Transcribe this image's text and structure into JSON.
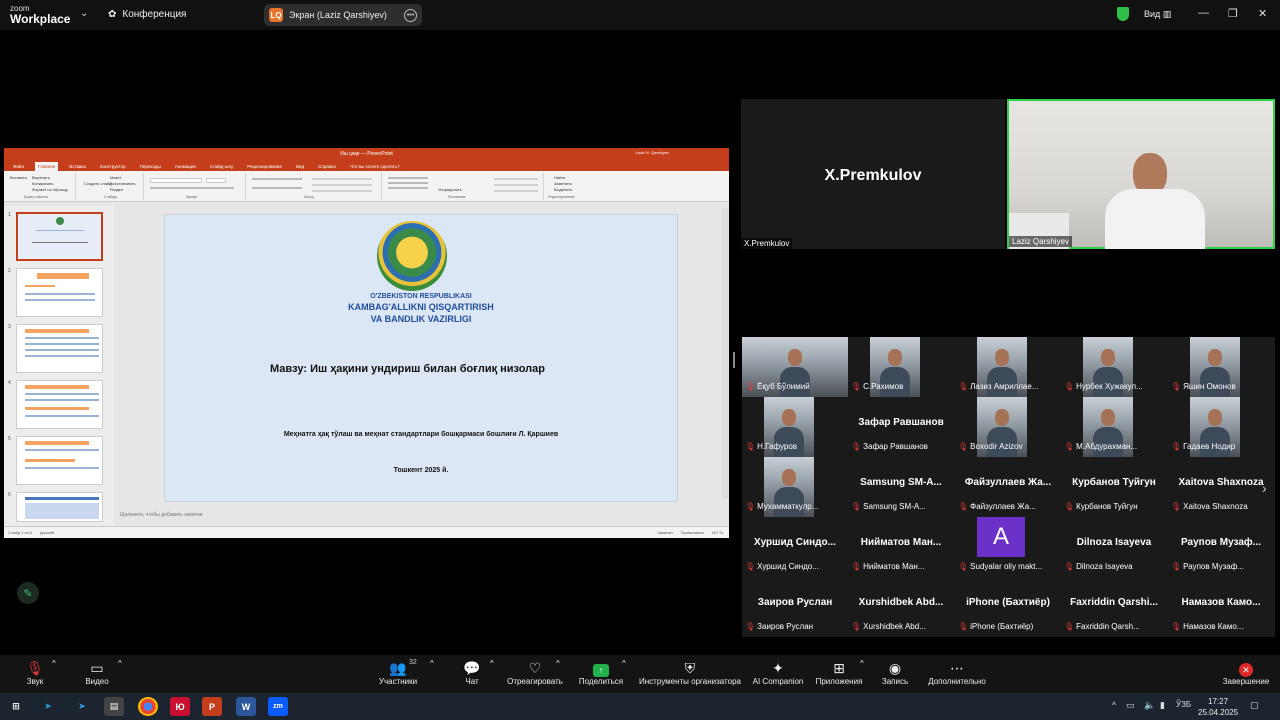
{
  "topbar": {
    "logo_line1": "zoom",
    "logo_line2": "Workplace",
    "conference_label": "Конференция",
    "share_badge": "LQ",
    "share_title": "Экран (Laziz Qarshiyev)",
    "view_label": "Вид",
    "colors": {
      "shield": "#2fbf4a",
      "share_badge": "#e8732a"
    }
  },
  "ppt": {
    "window_title": "Иш ҳақи — PowerPoint",
    "user_name": "Laziz N. Qarshiyev",
    "tabs": [
      "Файл",
      "Главная",
      "Вставка",
      "Конструктор",
      "Переходы",
      "Анимация",
      "Слайд-шоу",
      "Рецензирование",
      "Вид",
      "Справка",
      "Что вы хотите сделать?"
    ],
    "active_tab": "Главная",
    "ribbon": {
      "paste": "Вставить",
      "cut": "Вырезать",
      "copy": "Копировать",
      "format_painter": "Формат по образцу",
      "new_slide": "Создать слайд",
      "layout": "Макет",
      "reset": "Восстановить",
      "section": "Раздел",
      "arrange": "Упорядочить",
      "find": "Найти",
      "replace": "Заменить",
      "select": "Выделить",
      "groups": [
        "Буфер обмена",
        "Слайды",
        "Шрифт",
        "Абзац",
        "Рисование",
        "Редактирование"
      ]
    },
    "slide_numbers": [
      "1",
      "2",
      "3",
      "4",
      "5",
      "6"
    ],
    "slide": {
      "org_line1": "O'ZBEKISTON RESPUBLIKASI",
      "org_line2": "KAMBAG'ALLIKNI QISQARTIRISH",
      "org_line3": "VA BANDLIK VAZIRLIGI",
      "title": "Мавзу: Иш ҳақини ундириш билан боғлиқ низолар",
      "subtitle": "Меҳнатга ҳақ тўлаш ва меҳнат стандартлари бошқармаси бошлиғи Л. Қаршиев",
      "city": "Тошкент 2025 й."
    },
    "notes_placeholder": "Щелкните, чтобы добавить заметки",
    "status_slide": "Слайд 1 из 6",
    "status_lang": "русский",
    "status_notes": "Заметки",
    "status_comments": "Примечания",
    "status_zoom": "107 %"
  },
  "speakers": {
    "left": {
      "display_name": "X.Premkulov",
      "label": "X.Premkulov"
    },
    "right": {
      "label": "Laziz Qarshiyev"
    }
  },
  "gallery": [
    {
      "label": "Ёқуб Бўлимий",
      "video": true
    },
    {
      "label": "С.Рахимов",
      "video": true
    },
    {
      "label": "Лазиз Амриллае...",
      "video": true
    },
    {
      "label": "Нурбек Хужакул...",
      "video": true
    },
    {
      "label": "Яшин Омонов",
      "video": true
    },
    {
      "label": "Н.Гафуров",
      "video": true
    },
    {
      "label": "Зафар Равшанов",
      "big": "Зафар Равшанов",
      "video": false
    },
    {
      "label": "Boxodir Azizov",
      "video": true
    },
    {
      "label": "М.Абдурахман...",
      "video": true
    },
    {
      "label": "Гадаев Нодир",
      "video": true
    },
    {
      "label": "Мухамматкулр...",
      "video": true
    },
    {
      "label": "Samsung SM-A...",
      "big": "Samsung SM-A...",
      "video": false
    },
    {
      "label": "Файзуллаев Жа...",
      "big": "Файзуллаев Жа...",
      "video": false
    },
    {
      "label": "Курбанов Туйгун",
      "big": "Курбанов Туйгун",
      "video": false
    },
    {
      "label": "Xaitova Shaxnoza",
      "big": "Xaitova Shaxnoza",
      "video": false
    },
    {
      "label": "Хуршид Синдо...",
      "big": "Хуршид Синдо...",
      "video": false
    },
    {
      "label": "Нийматов Ман...",
      "big": "Нийматов Ман...",
      "video": false
    },
    {
      "label": "Sudyalar oliy makt...",
      "avatar": "A",
      "video": false
    },
    {
      "label": "Dilnoza Isayeva",
      "big": "Dilnoza Isayeva",
      "video": false
    },
    {
      "label": "Раупов Музаф...",
      "big": "Раупов Музаф...",
      "video": false
    },
    {
      "label": "Заиров Руслан",
      "big": "Заиров Руслан",
      "video": false
    },
    {
      "label": "Xurshidbek Abd...",
      "big": "Xurshidbek Abd...",
      "video": false
    },
    {
      "label": "iPhone (Бахтиёр)",
      "big": "iPhone (Бахтиёр)",
      "video": false
    },
    {
      "label": "Faxriddin Qarsh...",
      "big": "Faxriddin Qarshi...",
      "video": false
    },
    {
      "label": "Намазов Камо...",
      "big": "Намазов Камо...",
      "video": false
    }
  ],
  "toolbar": {
    "audio": "Звук",
    "video": "Видео",
    "participants": "Участники",
    "participants_count": "32",
    "chat": "Чат",
    "react": "Отреагировать",
    "share": "Поделиться",
    "host_tools": "Инструменты организатора",
    "ai_companion": "AI Companion",
    "apps": "Приложения",
    "record": "Запись",
    "more": "Дополнительно",
    "end": "Завершение"
  },
  "taskbar": {
    "lang": "ЎЗБ",
    "time": "17:27",
    "date": "25.04.2025"
  }
}
